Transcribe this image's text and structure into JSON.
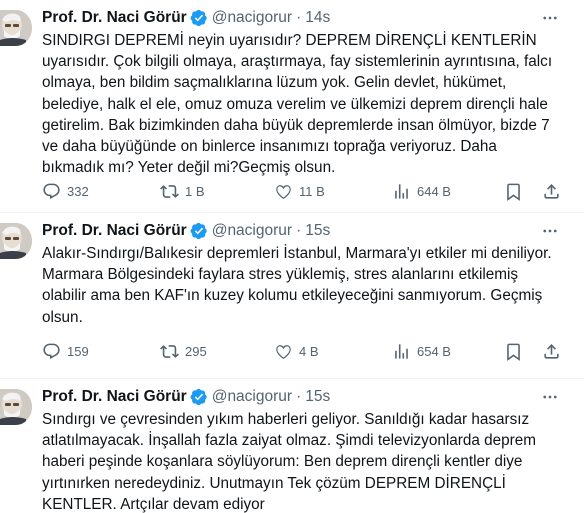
{
  "tweets": [
    {
      "author_name": "Prof. Dr. Naci Görür",
      "handle": "@nacigorur",
      "separator": "·",
      "time": "14s",
      "text": "SINDIRGI DEPREMİ neyin uyarısıdır? DEPREM DİRENÇLİ KENTLERİN uyarısıdır. Çok bilgili olmaya, araştırmaya, fay sistemlerinin ayrıntısına, falcı olmaya, ben bildim saçmalıklarına lüzum yok. Gelin devlet, hükümet, belediye, halk el ele, omuz omuza verelim ve ülkemizi deprem dirençli hale getirelim. Bak bizimkinden daha büyük depremlerde insan ölmüyor, bizde 7 ve daha büyüğünde on binlerce insanımızı toprağa veriyoruz. Daha bıkmadık mı? Yeter değil mi?Geçmiş olsun.",
      "replies": "332",
      "reposts": "1 B",
      "likes": "11 B",
      "views": "644 B"
    },
    {
      "author_name": "Prof. Dr. Naci Görür",
      "handle": "@nacigorur",
      "separator": "·",
      "time": "15s",
      "text": "Alakır-Sındırgı/Balıkesir depremleri İstanbul, Marmara'yı etkiler mi deniliyor. Marmara Bölgesindeki faylara stres yüklemiş, stres alanlarını etkilemiş olabilir ama ben KAF'ın kuzey kolumu etkileyeceğini sanmıyorum. Geçmiş olsun.",
      "replies": "159",
      "reposts": "295",
      "likes": "4 B",
      "views": "654 B"
    },
    {
      "author_name": "Prof. Dr. Naci Görür",
      "handle": "@nacigorur",
      "separator": "·",
      "time": "15s",
      "text": "Sındırgı ve çevresinden yıkım haberleri geliyor. Sanıldığı kadar hasarsız atlatılmayacak. İnşallah fazla zaiyat olmaz. Şimdi televizyonlarda deprem haberi peşinde koşanlara söylüyorum: Ben deprem dirençli kentler diye yırtınırken neredeydiniz. Unutmayın Tek çözüm DEPREM DİRENÇLİ KENTLER. Artçılar devam ediyor"
    }
  ],
  "icons": {
    "more": "more-horizontal-icon",
    "reply": "reply-icon",
    "repost": "repost-icon",
    "like": "like-icon",
    "views": "views-icon",
    "bookmark": "bookmark-icon",
    "share": "share-icon",
    "verified": "verified-badge-icon"
  },
  "colors": {
    "verified": "#1d9bf0",
    "muted": "#536471",
    "text": "#0f1419",
    "divider": "#eff3f4"
  }
}
